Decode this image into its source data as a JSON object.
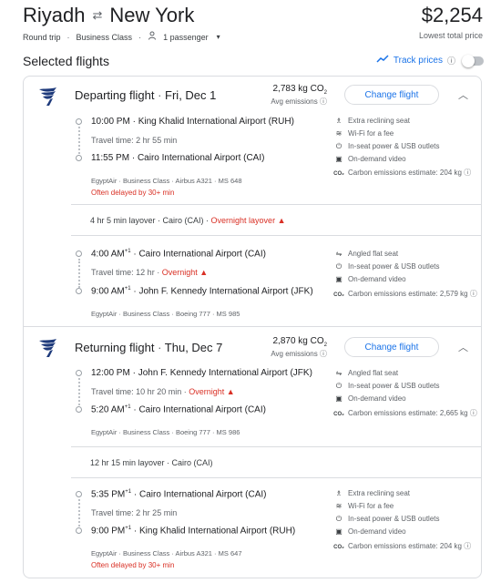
{
  "header": {
    "origin": "Riyadh",
    "destination": "New York",
    "swap_icon": "⇄",
    "trip_type": "Round trip",
    "cabin": "Business Class",
    "passengers": "1 passenger",
    "price": "$2,254",
    "price_note": "Lowest total price"
  },
  "selected_title": "Selected flights",
  "track_label": "Track prices",
  "departing": {
    "title": "Departing flight",
    "date": "Fri, Dec 1",
    "co2_value": "2,783 kg CO",
    "co2_sub": "2",
    "co2_avg": "Avg emissions",
    "change_label": "Change flight",
    "seg1": {
      "dep_time": "10:00 PM",
      "dep_airport": "King Khalid International Airport (RUH)",
      "travel": "Travel time: 2 hr 55 min",
      "arr_time": "11:55 PM",
      "arr_airport": "Cairo International Airport (CAI)",
      "meta": "EgyptAir · Business Class · Airbus A321 · MS 648",
      "delay": "Often delayed by 30+ min",
      "amenities": [
        "Extra reclining seat",
        "Wi-Fi for a fee",
        "In-seat power & USB outlets",
        "On-demand video",
        "Carbon emissions estimate: 204 kg"
      ]
    },
    "layover_text": "4 hr 5 min layover · Cairo (CAI) · ",
    "layover_flag": "Overnight layover",
    "seg2": {
      "dep_time": "4:00 AM",
      "dep_sup": "+1",
      "dep_airport": "Cairo International Airport (CAI)",
      "travel": "Travel time: 12 hr · ",
      "travel_flag": "Overnight",
      "arr_time": "9:00 AM",
      "arr_sup": "+1",
      "arr_airport": "John F. Kennedy International Airport (JFK)",
      "meta": "EgyptAir · Business Class · Boeing 777 · MS 985",
      "amenities": [
        "Angled flat seat",
        "In-seat power & USB outlets",
        "On-demand video",
        "Carbon emissions estimate: 2,579 kg"
      ]
    }
  },
  "returning": {
    "title": "Returning flight",
    "date": "Thu, Dec 7",
    "co2_value": "2,870 kg CO",
    "co2_sub": "2",
    "co2_avg": "Avg emissions",
    "change_label": "Change flight",
    "seg1": {
      "dep_time": "12:00 PM",
      "dep_airport": "John F. Kennedy International Airport (JFK)",
      "travel": "Travel time: 10 hr 20 min · ",
      "travel_flag": "Overnight",
      "arr_time": "5:20 AM",
      "arr_sup": "+1",
      "arr_airport": "Cairo International Airport (CAI)",
      "meta": "EgyptAir · Business Class · Boeing 777 · MS 986",
      "amenities": [
        "Angled flat seat",
        "In-seat power & USB outlets",
        "On-demand video",
        "Carbon emissions estimate: 2,665 kg"
      ]
    },
    "layover_text": "12 hr 15 min layover · Cairo (CAI)",
    "seg2": {
      "dep_time": "5:35 PM",
      "dep_sup": "+1",
      "dep_airport": "Cairo International Airport (CAI)",
      "travel": "Travel time: 2 hr 25 min",
      "arr_time": "9:00 PM",
      "arr_sup": "+1",
      "arr_airport": "King Khalid International Airport (RUH)",
      "meta": "EgyptAir · Business Class · Airbus A321 · MS 647",
      "delay": "Often delayed by 30+ min",
      "amenities": [
        "Extra reclining seat",
        "Wi-Fi for a fee",
        "In-seat power & USB outlets",
        "On-demand video",
        "Carbon emissions estimate: 204 kg"
      ]
    }
  },
  "icons": {
    "seat": "seat-icon",
    "wifi": "wifi-icon",
    "power": "power-icon",
    "video": "video-icon",
    "co2": "co2-icon",
    "warning": "warning-icon",
    "chevron": "chevron-up-icon"
  },
  "colors": {
    "accent": "#1a73e8",
    "warning": "#d93025",
    "logo": "#1e3a7b"
  }
}
